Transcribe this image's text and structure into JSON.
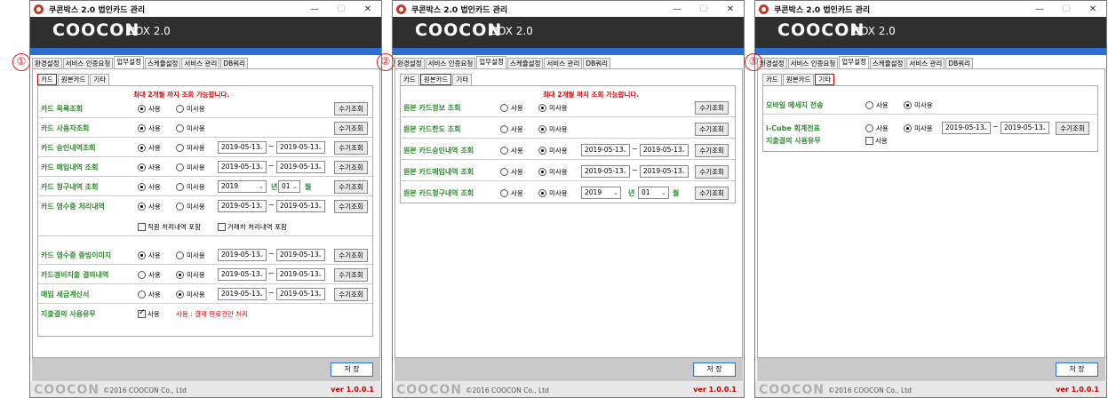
{
  "window": {
    "title": "쿠콘박스 2.0 법인카드 관리",
    "min": "—",
    "max": "☐",
    "close": "✕"
  },
  "brand": {
    "logo": "COOCON",
    "sub": "BOX 2.0"
  },
  "main_tabs": [
    "환경설정",
    "서비스 인증요청",
    "업무설정",
    "스케쥴설정",
    "서비스 관리",
    "DB쿼리"
  ],
  "sub_tabs": [
    "카드",
    "원본카드",
    "기타"
  ],
  "markers": [
    "①",
    "②",
    "③"
  ],
  "notice": "최대 2개월 까지 조회 가능합니다.",
  "radio": {
    "use": "사용",
    "nouse": "미사용"
  },
  "manual_btn": "수기조회",
  "date_from": "2019-05-13",
  "date_to": "2019-05-13",
  "tilde": "~",
  "year": "2019",
  "month": "01",
  "year_unit": "년",
  "month_unit": "월",
  "card_rows": [
    {
      "label": "카드 목록조회"
    },
    {
      "label": "카드 사용자조회"
    },
    {
      "label": "카드 승인내역조회"
    },
    {
      "label": "카드 매입내역 조회"
    },
    {
      "label": "카드 청구내역 조회"
    },
    {
      "label": "카드 영수증 처리내역"
    },
    {
      "label": "카드 영수증 증빙이미지"
    },
    {
      "label": "카드경비지출 결의내역"
    },
    {
      "label": "매입 세금계산서"
    },
    {
      "label": "지출결의 사용유무"
    }
  ],
  "receipt_checks": [
    "직원 처리내역 포함",
    "거래처 처리내역 포함"
  ],
  "approval_check": "사용",
  "approval_note": "사용 : 결재 완료건만 처리",
  "orig_rows": [
    {
      "label": "원본 카드정보 조회"
    },
    {
      "label": "원본 카드한도 조회"
    },
    {
      "label": "원본 카드승인내역 조회"
    },
    {
      "label": "원본 카드매입내역 조회"
    },
    {
      "label": "원본 카드청구내역 조회"
    }
  ],
  "etc": {
    "mobile_label": "모바일 메세지 전송",
    "icube_label": "i-Cube 회계전표",
    "approval_label": "지출결의 사용유무",
    "approval_check": "사용"
  },
  "save": "저 장",
  "footer": {
    "logo": "COOCON",
    "copyright": "©2016 COOCON Co., Ltd",
    "version": "ver 1.0.0.1"
  }
}
